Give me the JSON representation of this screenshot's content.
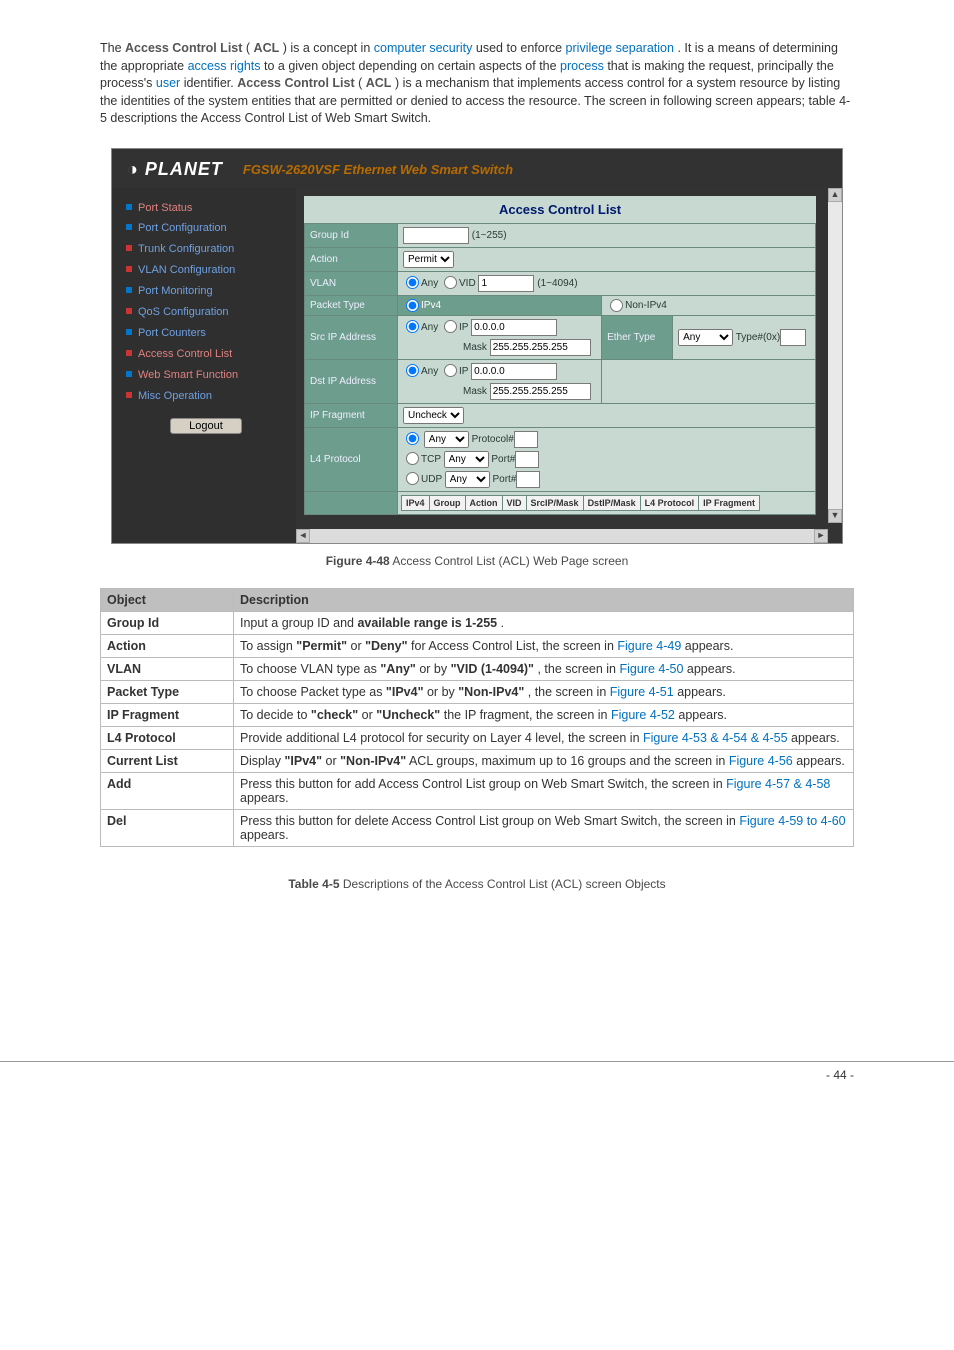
{
  "intro": {
    "t0": "The ",
    "acl_full": "Access Control List",
    "t1": " (",
    "acl_short": "ACL",
    "t2": ") is a concept in ",
    "link_cs": "computer security",
    "t3": " used to enforce ",
    "link_ps": "privilege separation",
    "t4": ". It is a means of determining the appropriate ",
    "link_ar": "access rights",
    "t5": " to a given object depending on certain aspects of the ",
    "link_proc": "process",
    "t6": " that is making the request, principally the process's ",
    "link_user": "user",
    "t7": " identifier. ",
    "acl_full2": "Access Control List",
    "t8": " (",
    "acl_short2": "ACL",
    "t9": ") is a mechanism that implements access control for a system resource by listing the identities of the system entities that are permitted or denied to access the resource. The screen in following screen appears; table 4-5 descriptions the Access Control List of Web Smart Switch."
  },
  "screenshot": {
    "brand": "PLANET",
    "product_line": "FGSW-2620VSF Ethernet Web Smart Switch",
    "nav": {
      "port_status": "Port Status",
      "port_config": "Port Configuration",
      "trunk_config": "Trunk Configuration",
      "vlan_config": "VLAN Configuration",
      "port_monitoring": "Port Monitoring",
      "qos_config": "QoS Configuration",
      "port_counters": "Port Counters",
      "acl": "Access Control List",
      "web_smart": "Web Smart Function",
      "misc": "Misc Operation",
      "logout": "Logout"
    },
    "panel": {
      "title": "Access Control List",
      "group_id": "Group Id",
      "group_hint": "(1~255)",
      "action": "Action",
      "action_value": "Permit",
      "vlan": "VLAN",
      "vlan_any": "Any",
      "vlan_vid": "VID",
      "vlan_vid_value": "1",
      "vlan_hint": "(1~4094)",
      "packet_type": "Packet Type",
      "ipv4": "IPv4",
      "non_ipv4": "Non-IPv4",
      "src_ip": "Src IP Address",
      "dst_ip": "Dst IP Address",
      "ether_type": "Ether Type",
      "ether_value": "Any",
      "ether_type_hint": "Type#(0x)",
      "any": "Any",
      "ip_label": "IP",
      "ip_default": "0.0.0.0",
      "mask_label": "Mask",
      "mask_default": "255.255.255.255",
      "ip_fragment": "IP Fragment",
      "ip_fragment_value": "Uncheck",
      "l4_protocol": "L4 Protocol",
      "protocol_hint": "Protocol#",
      "tcp": "TCP",
      "udp": "UDP",
      "port_hint": "Port#",
      "head": {
        "ipv4": "IPv4",
        "group": "Group",
        "action": "Action",
        "vid": "VID",
        "src": "SrcIP/Mask",
        "dst": "DstIP/Mask",
        "l4": "L4 Protocol",
        "frag": "IP Fragment"
      }
    }
  },
  "fig_caption": {
    "prefix": "Figure 4-48",
    "text": " Access Control List (ACL) Web Page screen"
  },
  "table": {
    "header_obj": "Object",
    "header_desc": "Description",
    "rows": {
      "group_id": {
        "obj": "Group Id",
        "t0": "Input a group ID and ",
        "b0": "available range is 1-255",
        "t1": "."
      },
      "action": {
        "obj": "Action",
        "t0": "To assign ",
        "b0": "\"Permit\"",
        "t1": " or ",
        "b1": "\"Deny\"",
        "t2": " for Access Control List, the screen in ",
        "link": "Figure 4-49",
        "t3": " appears."
      },
      "vlan": {
        "obj": "VLAN",
        "t0": "To choose VLAN type as ",
        "b0": "\"Any\"",
        "t1": " or by ",
        "b1": "\"VID (1-4094)\"",
        "t2": ", the screen in ",
        "link": "Figure 4-50",
        "t3": " appears."
      },
      "packet_type": {
        "obj": "Packet Type",
        "t0": "To choose Packet type as ",
        "b0": "\"IPv4\"",
        "t1": " or by ",
        "b1": "\"Non-IPv4\"",
        "t2": ", the screen in ",
        "link": "Figure 4-51",
        "t3": " appears."
      },
      "ip_fragment": {
        "obj": "IP Fragment",
        "t0": "To decide to ",
        "b0": "\"check\"",
        "t1": " or ",
        "b1": "\"Uncheck\"",
        "t2": " the IP fragment, the screen in ",
        "link": "Figure 4-52",
        "t3": " appears."
      },
      "l4_protocol": {
        "obj": "L4 Protocol",
        "t0": "Provide additional L4 protocol for security on Layer 4 level, the screen in ",
        "link": "Figure 4-53 & 4-54 & 4-55",
        "t1": " appears."
      },
      "current_list": {
        "obj": "Current List",
        "t0": "Display ",
        "b0": "\"IPv4\"",
        "t1": " or ",
        "b1": "\"Non-IPv4\"",
        "t2": " ACL groups, maximum up to 16 groups and the screen in ",
        "link": "Figure 4-56",
        "t3": " appears."
      },
      "add": {
        "obj": "Add",
        "t0": "Press this button for add Access Control List group on Web Smart Switch, the screen in ",
        "link": "Figure 4-57 & 4-58",
        "t1": " appears."
      },
      "del": {
        "obj": "Del",
        "t0": "Press this button for delete Access Control List group on Web Smart Switch, the screen in ",
        "link": "Figure 4-59 to 4-60",
        "t1": " appears."
      }
    }
  },
  "table_caption": {
    "prefix": "Table 4-5",
    "text": " Descriptions of the Access Control List (ACL) screen Objects"
  },
  "page_number": "- 44 -"
}
